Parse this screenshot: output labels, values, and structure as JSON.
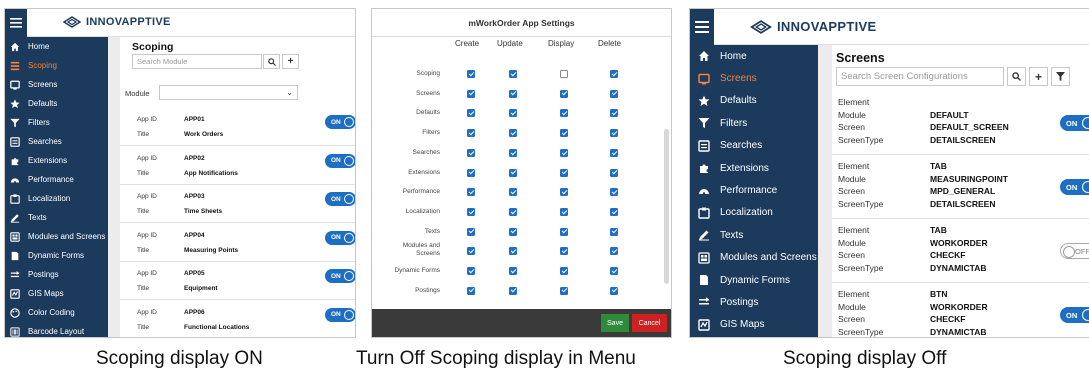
{
  "brand": "INNOVAPPTIVE",
  "sidebar_items": [
    {
      "label": "Home",
      "icon": "home-icon"
    },
    {
      "label": "Scoping",
      "icon": "scoping-icon"
    },
    {
      "label": "Screens",
      "icon": "screen-icon"
    },
    {
      "label": "Defaults",
      "icon": "star-icon"
    },
    {
      "label": "Filters",
      "icon": "filter-icon"
    },
    {
      "label": "Searches",
      "icon": "searches-icon"
    },
    {
      "label": "Extensions",
      "icon": "puzzle-icon"
    },
    {
      "label": "Performance",
      "icon": "gauge-icon"
    },
    {
      "label": "Localization",
      "icon": "localization-icon"
    },
    {
      "label": "Texts",
      "icon": "pen-icon"
    },
    {
      "label": "Modules and Screens",
      "icon": "modules-icon"
    },
    {
      "label": "Dynamic Forms",
      "icon": "form-icon"
    },
    {
      "label": "Postings",
      "icon": "postings-icon"
    },
    {
      "label": "GIS Maps",
      "icon": "map-icon"
    },
    {
      "label": "Color Coding",
      "icon": "palette-icon"
    },
    {
      "label": "Barcode Layout",
      "icon": "barcode-icon"
    }
  ],
  "panel1": {
    "active_item": "Scoping",
    "title": "Scoping",
    "search_placeholder": "Search Module",
    "module_label": "Module",
    "module_value": "",
    "labels": {
      "app_id": "App ID",
      "title": "Title"
    },
    "toggle_on": "ON",
    "apps": [
      {
        "app_id": "APP01",
        "title": "Work Orders",
        "state": "ON"
      },
      {
        "app_id": "APP02",
        "title": "App Notifications",
        "state": "ON"
      },
      {
        "app_id": "APP03",
        "title": "Time Sheets",
        "state": "ON"
      },
      {
        "app_id": "APP04",
        "title": "Measuring Points",
        "state": "ON"
      },
      {
        "app_id": "APP05",
        "title": "Equipment",
        "state": "ON"
      },
      {
        "app_id": "APP06",
        "title": "Functional Locations",
        "state": "ON"
      }
    ]
  },
  "panel2": {
    "title": "mWorkOrder App Settings",
    "columns": [
      "Create",
      "Update",
      "Display",
      "Delete"
    ],
    "rows": [
      {
        "label": "Scoping",
        "create": true,
        "update": true,
        "display": false,
        "delete": true
      },
      {
        "label": "Screens",
        "create": true,
        "update": true,
        "display": true,
        "delete": true
      },
      {
        "label": "Defaults",
        "create": true,
        "update": true,
        "display": true,
        "delete": true
      },
      {
        "label": "Filters",
        "create": true,
        "update": true,
        "display": true,
        "delete": true
      },
      {
        "label": "Searches",
        "create": true,
        "update": true,
        "display": true,
        "delete": true
      },
      {
        "label": "Extensions",
        "create": true,
        "update": true,
        "display": true,
        "delete": true
      },
      {
        "label": "Performance",
        "create": true,
        "update": true,
        "display": true,
        "delete": true
      },
      {
        "label": "Localization",
        "create": true,
        "update": true,
        "display": true,
        "delete": true
      },
      {
        "label": "Texts",
        "create": true,
        "update": true,
        "display": true,
        "delete": true
      },
      {
        "label": "Modules and Screens",
        "create": true,
        "update": true,
        "display": true,
        "delete": true
      },
      {
        "label": "Dynamic Forms",
        "create": true,
        "update": true,
        "display": true,
        "delete": true
      },
      {
        "label": "Postings",
        "create": true,
        "update": true,
        "display": true,
        "delete": true
      }
    ],
    "save_label": "Save",
    "cancel_label": "Cancel"
  },
  "panel3": {
    "active_item": "Screens",
    "title": "Screens",
    "search_placeholder": "Search Screen Configurations",
    "labels": {
      "element": "Element",
      "module": "Module",
      "screen": "Screen",
      "screentype": "ScreenType"
    },
    "screens": [
      {
        "element": "",
        "module": "DEFAULT",
        "screen": "DEFAULT_SCREEN",
        "screentype": "DETAILSCREEN",
        "state": "ON"
      },
      {
        "element": "TAB",
        "module": "MEASURINGPOINT",
        "screen": "MPD_GENERAL",
        "screentype": "DETAILSCREEN",
        "state": "ON"
      },
      {
        "element": "TAB",
        "module": "WORKORDER",
        "screen": "CHECKF",
        "screentype": "DYNAMICTAB",
        "state": "OFF"
      },
      {
        "element": "BTN",
        "module": "WORKORDER",
        "screen": "CHECKF",
        "screentype": "DYNAMICTAB",
        "state": "ON"
      }
    ]
  },
  "captions": [
    "Scoping display ON",
    "Turn Off Scoping display in Menu",
    "Scoping display Off"
  ],
  "colors": {
    "sidebar": "#1b3a5c",
    "active": "#f0833a",
    "accent": "#1e6fc4",
    "save": "#2e8b3a",
    "cancel": "#cc2222"
  }
}
